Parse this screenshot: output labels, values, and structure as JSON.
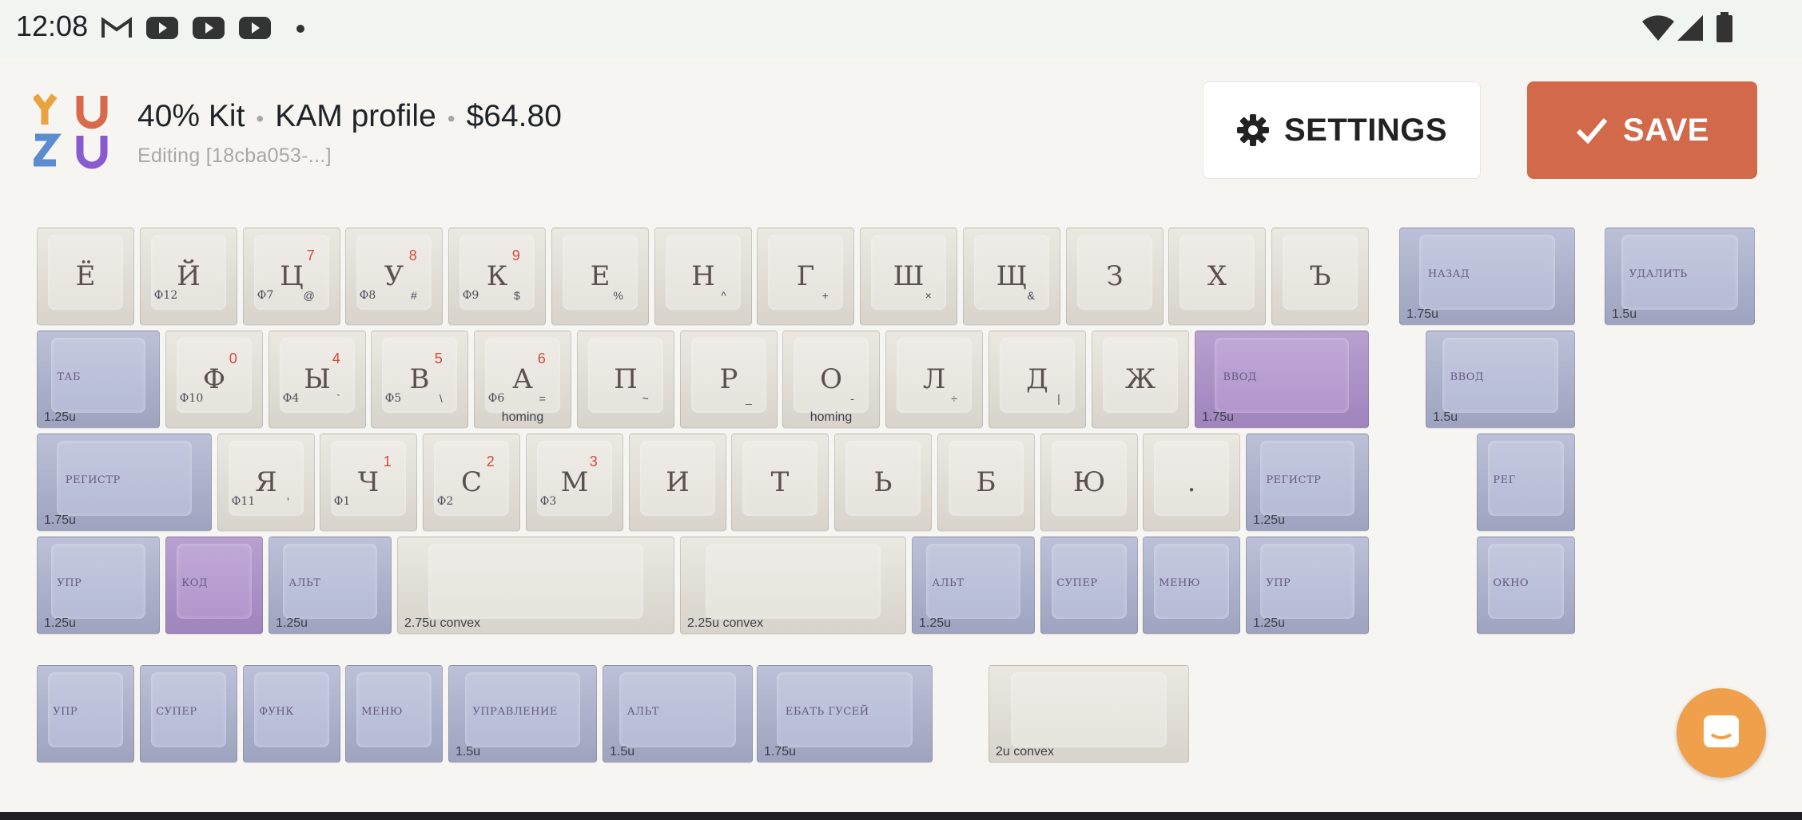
{
  "status_bar": {
    "time": "12:08",
    "icons": [
      "gmail-icon",
      "youtube-icon",
      "youtube-icon",
      "youtube-icon",
      "dot-icon",
      "wifi-icon",
      "signal-icon",
      "battery-icon"
    ]
  },
  "logo": {
    "letters": [
      "Y",
      "U",
      "Z",
      "U"
    ],
    "colors": [
      "#e9a33f",
      "#d8694a",
      "#5a8ccf",
      "#8a5bd0"
    ]
  },
  "kit": {
    "name": "40% Kit",
    "profile": "KAM profile",
    "price": "$64.80",
    "separator": "•",
    "editing": "Editing [18cba053-...]"
  },
  "buttons": {
    "settings": "SETTINGS",
    "save": "SAVE"
  },
  "colors": {
    "cream": "#e3dfd8",
    "blue": "#aeb2cc",
    "purple": "#ab90c6",
    "save": "#d1694a",
    "chat": "#f0a04a",
    "red_number": "#d44a3a"
  },
  "keys": [
    {
      "id": "k-yo",
      "legend": "Ё",
      "color": "cream"
    },
    {
      "id": "k-y",
      "legend": "Й",
      "sub_left": "Ф12",
      "color": "cream"
    },
    {
      "id": "k-ts",
      "legend": "Ц",
      "sub_left": "Ф7",
      "sub_right": "@",
      "number": "7",
      "color": "cream"
    },
    {
      "id": "k-u",
      "legend": "У",
      "sub_left": "Ф8",
      "sub_right": "#",
      "number": "8",
      "color": "cream"
    },
    {
      "id": "k-k",
      "legend": "К",
      "sub_left": "Ф9",
      "sub_right": "$",
      "number": "9",
      "color": "cream"
    },
    {
      "id": "k-e",
      "legend": "Е",
      "sub_right": "%",
      "color": "cream"
    },
    {
      "id": "k-n",
      "legend": "Н",
      "sub_right": "^",
      "color": "cream"
    },
    {
      "id": "k-g",
      "legend": "Г",
      "sub_right": "+",
      "color": "cream"
    },
    {
      "id": "k-sh",
      "legend": "Ш",
      "sub_right": "×",
      "color": "cream"
    },
    {
      "id": "k-shch",
      "legend": "Щ",
      "sub_right": "&",
      "color": "cream"
    },
    {
      "id": "k-z",
      "legend": "З",
      "color": "cream"
    },
    {
      "id": "k-kh",
      "legend": "Х",
      "color": "cream"
    },
    {
      "id": "k-hard",
      "legend": "Ъ",
      "color": "cream"
    },
    {
      "id": "k-back",
      "mod": "НАЗАД",
      "size": "1.75u",
      "color": "blue"
    },
    {
      "id": "k-del",
      "mod": "УДАЛИТЬ",
      "size": "1.5u",
      "color": "blue"
    },
    {
      "id": "k-tab",
      "mod": "ТАБ",
      "size": "1.25u",
      "color": "blue"
    },
    {
      "id": "k-f",
      "legend": "Ф",
      "sub_left": "Ф10",
      "number": "0",
      "color": "cream"
    },
    {
      "id": "k-yi",
      "legend": "Ы",
      "sub_left": "Ф4",
      "sub_right": "`",
      "number": "4",
      "color": "cream"
    },
    {
      "id": "k-v",
      "legend": "В",
      "sub_left": "Ф5",
      "sub_right": "\\",
      "number": "5",
      "color": "cream"
    },
    {
      "id": "k-a",
      "legend": "А",
      "sub_left": "Ф6",
      "sub_right": "=",
      "number": "6",
      "homing": "homing",
      "color": "cream"
    },
    {
      "id": "k-p",
      "legend": "П",
      "sub_right": "~",
      "color": "cream"
    },
    {
      "id": "k-r",
      "legend": "Р",
      "sub_right": "_",
      "color": "cream"
    },
    {
      "id": "k-o",
      "legend": "О",
      "sub_right": "-",
      "homing": "homing",
      "color": "cream"
    },
    {
      "id": "k-l",
      "legend": "Л",
      "sub_right": "÷",
      "color": "cream"
    },
    {
      "id": "k-d",
      "legend": "Д",
      "sub_right": "|",
      "color": "cream"
    },
    {
      "id": "k-zh",
      "legend": "Ж",
      "color": "cream"
    },
    {
      "id": "k-enter",
      "mod": "ВВОД",
      "size": "1.75u",
      "color": "purple"
    },
    {
      "id": "k-enter2",
      "mod": "ВВОД",
      "size": "1.5u",
      "color": "blue"
    },
    {
      "id": "k-shift-l",
      "mod": "РЕГИСТР",
      "size": "1.75u",
      "color": "blue"
    },
    {
      "id": "k-ya",
      "legend": "Я",
      "sub_left": "Ф11",
      "sub_right": "'",
      "color": "cream"
    },
    {
      "id": "k-ch",
      "legend": "Ч",
      "sub_left": "Ф1",
      "number": "1",
      "color": "cream"
    },
    {
      "id": "k-s",
      "legend": "С",
      "sub_left": "Ф2",
      "number": "2",
      "color": "cream"
    },
    {
      "id": "k-m",
      "legend": "М",
      "sub_left": "Ф3",
      "number": "3",
      "color": "cream"
    },
    {
      "id": "k-i",
      "legend": "И",
      "color": "cream"
    },
    {
      "id": "k-t",
      "legend": "Т",
      "color": "cream"
    },
    {
      "id": "k-soft",
      "legend": "Ь",
      "color": "cream"
    },
    {
      "id": "k-b",
      "legend": "Б",
      "color": "cream"
    },
    {
      "id": "k-yu",
      "legend": "Ю",
      "color": "cream"
    },
    {
      "id": "k-dot",
      "legend": ".",
      "color": "cream"
    },
    {
      "id": "k-shift-r",
      "mod": "РЕГИСТР",
      "size": "1.25u",
      "color": "blue"
    },
    {
      "id": "k-shift-alt",
      "mod": "РЕГ",
      "color": "blue"
    },
    {
      "id": "k-ctrl-l",
      "mod": "УПР",
      "size": "1.25u",
      "color": "blue"
    },
    {
      "id": "k-code",
      "mod": "КОД",
      "color": "purple"
    },
    {
      "id": "k-alt-l",
      "mod": "АЛЬТ",
      "size": "1.25u",
      "color": "blue"
    },
    {
      "id": "k-space-l",
      "size": "2.75u convex",
      "color": "cream"
    },
    {
      "id": "k-space-r",
      "size": "2.25u convex",
      "color": "cream"
    },
    {
      "id": "k-alt-r",
      "mod": "АЛЬТ",
      "size": "1.25u",
      "color": "blue"
    },
    {
      "id": "k-super-r",
      "mod": "СУПЕР",
      "color": "blue"
    },
    {
      "id": "k-menu-r",
      "mod": "МЕНЮ",
      "color": "blue"
    },
    {
      "id": "k-ctrl-r",
      "mod": "УПР",
      "size": "1.25u",
      "color": "blue"
    },
    {
      "id": "k-window",
      "mod": "ОКНО",
      "color": "blue"
    },
    {
      "id": "x-ctrl",
      "mod": "УПР",
      "color": "blue"
    },
    {
      "id": "x-super",
      "mod": "СУПЕР",
      "color": "blue"
    },
    {
      "id": "x-func",
      "mod": "ФУНК",
      "color": "blue"
    },
    {
      "id": "x-menu",
      "mod": "МЕНЮ",
      "color": "blue"
    },
    {
      "id": "x-control",
      "mod": "УПРАВЛЕНИЕ",
      "size": "1.5u",
      "color": "blue"
    },
    {
      "id": "x-alt",
      "mod": "АЛЬТ",
      "size": "1.5u",
      "color": "blue"
    },
    {
      "id": "x-geese",
      "mod": "ЕБАТЬ ГУСЕЙ",
      "size": "1.75u",
      "color": "blue"
    },
    {
      "id": "x-space",
      "size": "2u convex",
      "color": "cream"
    }
  ]
}
